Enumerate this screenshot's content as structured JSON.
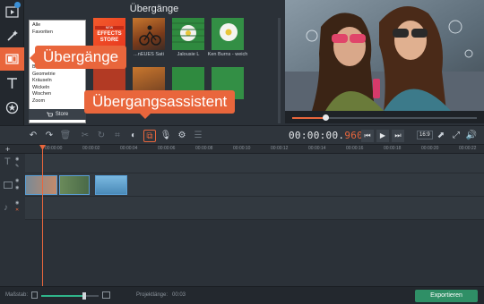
{
  "panel": {
    "title": "Übergänge",
    "categories": [
      "Alle",
      "Favoriten",
      "Blöcke",
      "Geometrie",
      "Kräuseln",
      "Wickeln",
      "Wischen",
      "Zoom"
    ],
    "store_label": "Store",
    "thumbnails": [
      {
        "label": "EFFECTS STORE"
      },
      {
        "label": "ORIGINALTEXT"
      },
      {
        "label": "Jalousie L"
      },
      {
        "label": "Ken Burns - weich"
      }
    ],
    "thumb_labels_visible": [
      "...nEUES Sati",
      "Jalousie L",
      "Ken Burns - weich"
    ],
    "effects_store_text": "EFFECTS STORE",
    "effects_store_small": "NEW"
  },
  "callouts": {
    "transitions": "Übergänge",
    "assistant": "Übergangsassistent"
  },
  "player": {
    "timecode_main": "00:00:00.",
    "timecode_ms": "960",
    "ratio": "16:9",
    "progress": 0.18
  },
  "ruler": {
    "ticks": [
      "00:00:00",
      "00:00:02",
      "00:00:04",
      "00:00:06",
      "00:00:08",
      "00:00:10",
      "00:00:12",
      "00:00:14",
      "00:00:16",
      "00:00:18",
      "00:00:20",
      "00:00:22"
    ]
  },
  "status": {
    "zoom_label": "Maßstab:",
    "project_length_label": "Projektlänge:",
    "project_length": "00:03",
    "export_label": "Exportieren",
    "zoom_level": 0.75
  },
  "colors": {
    "accent": "#e9663c",
    "export": "#2f8f66"
  },
  "icons": {
    "rail": [
      "import-icon",
      "magic-wand-icon",
      "transitions-icon",
      "text-icon",
      "stickers-icon",
      "more-icon"
    ]
  }
}
